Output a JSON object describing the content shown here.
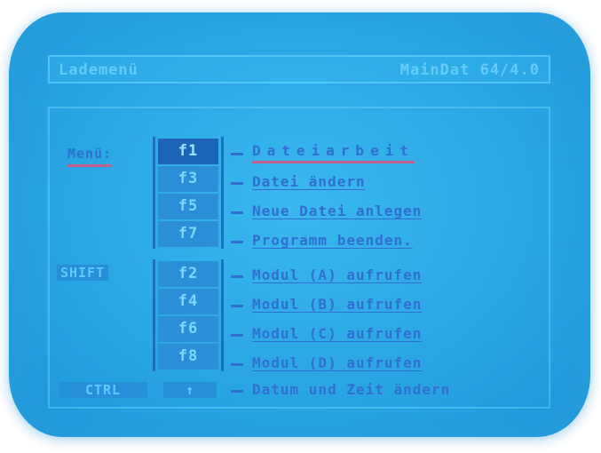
{
  "header": {
    "title": "Lademenü",
    "app_version": "MainDat 64/4.0"
  },
  "menu": {
    "menu_label": "Menü:",
    "shift_label": "SHIFT",
    "ctrl_label": "CTRL",
    "ctrl_key": "↑",
    "items": [
      {
        "key": "f1",
        "label": "Dateiarbeit"
      },
      {
        "key": "f3",
        "label": "Datei ändern"
      },
      {
        "key": "f5",
        "label": "Neue Datei anlegen"
      },
      {
        "key": "f7",
        "label": "Programm beenden."
      },
      {
        "key": "f2",
        "label": "Modul (A) aufrufen"
      },
      {
        "key": "f4",
        "label": "Modul (B) aufrufen"
      },
      {
        "key": "f6",
        "label": "Modul (C) aufrufen"
      },
      {
        "key": "f8",
        "label": "Modul (D) aufrufen"
      }
    ],
    "ctrl_item_label": "Datum und Zeit ändern"
  },
  "colors": {
    "screen": "#2aa6e4",
    "text": "#2f6fd0",
    "highlight_underline": "#c0608a"
  }
}
